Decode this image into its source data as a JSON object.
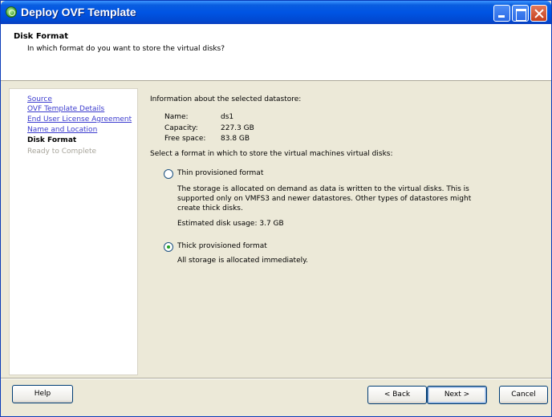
{
  "window": {
    "title": "Deploy OVF Template",
    "controls": {
      "minimize": "minimize-icon",
      "maximize": "maximize-icon",
      "close": "close-icon"
    },
    "colors": {
      "titlebar": "#0054e3",
      "face": "#ece9d8",
      "link": "#3b3bce",
      "radio_dot": "#21a121"
    }
  },
  "header": {
    "title": "Disk Format",
    "subtitle": "In which format do you want to store the virtual disks?"
  },
  "nav": {
    "items": [
      {
        "label": "Source",
        "state": "link"
      },
      {
        "label": "OVF Template Details",
        "state": "link"
      },
      {
        "label": "End User License Agreement",
        "state": "link"
      },
      {
        "label": "Name and Location",
        "state": "link"
      },
      {
        "label": "Disk Format",
        "state": "current"
      },
      {
        "label": "Ready to Complete",
        "state": "disabled"
      }
    ]
  },
  "datastore": {
    "heading": "Information about the selected datastore:",
    "name_label": "Name:",
    "name_value": "ds1",
    "capacity_label": "Capacity:",
    "capacity_value": "227.3 GB",
    "free_label": "Free space:",
    "free_value": "83.8 GB"
  },
  "format": {
    "prompt": "Select a format in which to store the virtual machines virtual disks:",
    "thin": {
      "label": "Thin provisioned format",
      "checked": false,
      "desc_line1": "The storage is allocated on demand as data is written to the virtual disks. This is",
      "desc_line2": "supported only on VMFS3 and newer datastores. Other types of datastores might",
      "desc_line3": "create thick disks.",
      "estimate": "Estimated disk usage: 3.7 GB"
    },
    "thick": {
      "label": "Thick provisioned format",
      "checked": true,
      "desc": "All storage is allocated immediately."
    }
  },
  "buttons": {
    "help": "Help",
    "back": "< Back",
    "next": "Next >",
    "cancel": "Cancel"
  }
}
